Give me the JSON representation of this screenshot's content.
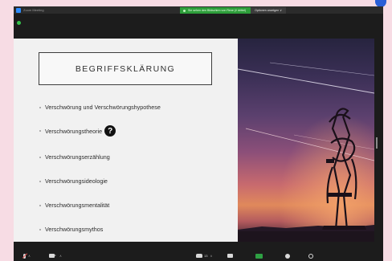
{
  "window": {
    "title": "Zoom Meeting"
  },
  "share_bar": {
    "status_text": "Sie sehen den Bildschirm von Rene (// drittel)",
    "options_label": "Optionen anzeigen ∨"
  },
  "slide": {
    "title": "BEGRIFFSKLÄRUNG",
    "bullets": [
      "Verschwörung und Verschwörungshypothese",
      "Verschwörungstheorie",
      "Verschwörungserzählung",
      "Verschwörungsideologie",
      "Verschwörungsmentalität",
      "Verschwörungsmythos"
    ],
    "help_glyph": "?"
  },
  "toolbar": {
    "participants_count": "13",
    "caret": "∧"
  },
  "icons": {
    "app": "zoom-app-icon",
    "help": "question-mark-icon",
    "mic": "mic-muted-icon",
    "camera": "camera-icon",
    "participants": "participants-icon",
    "chat": "chat-icon",
    "share": "share-screen-icon",
    "record": "record-icon",
    "reactions": "reactions-icon"
  },
  "colors": {
    "background": "#f7dce4",
    "share_status": "#2e9e3b",
    "status_dot": "#35c24a",
    "accent": "#2d8cff"
  }
}
